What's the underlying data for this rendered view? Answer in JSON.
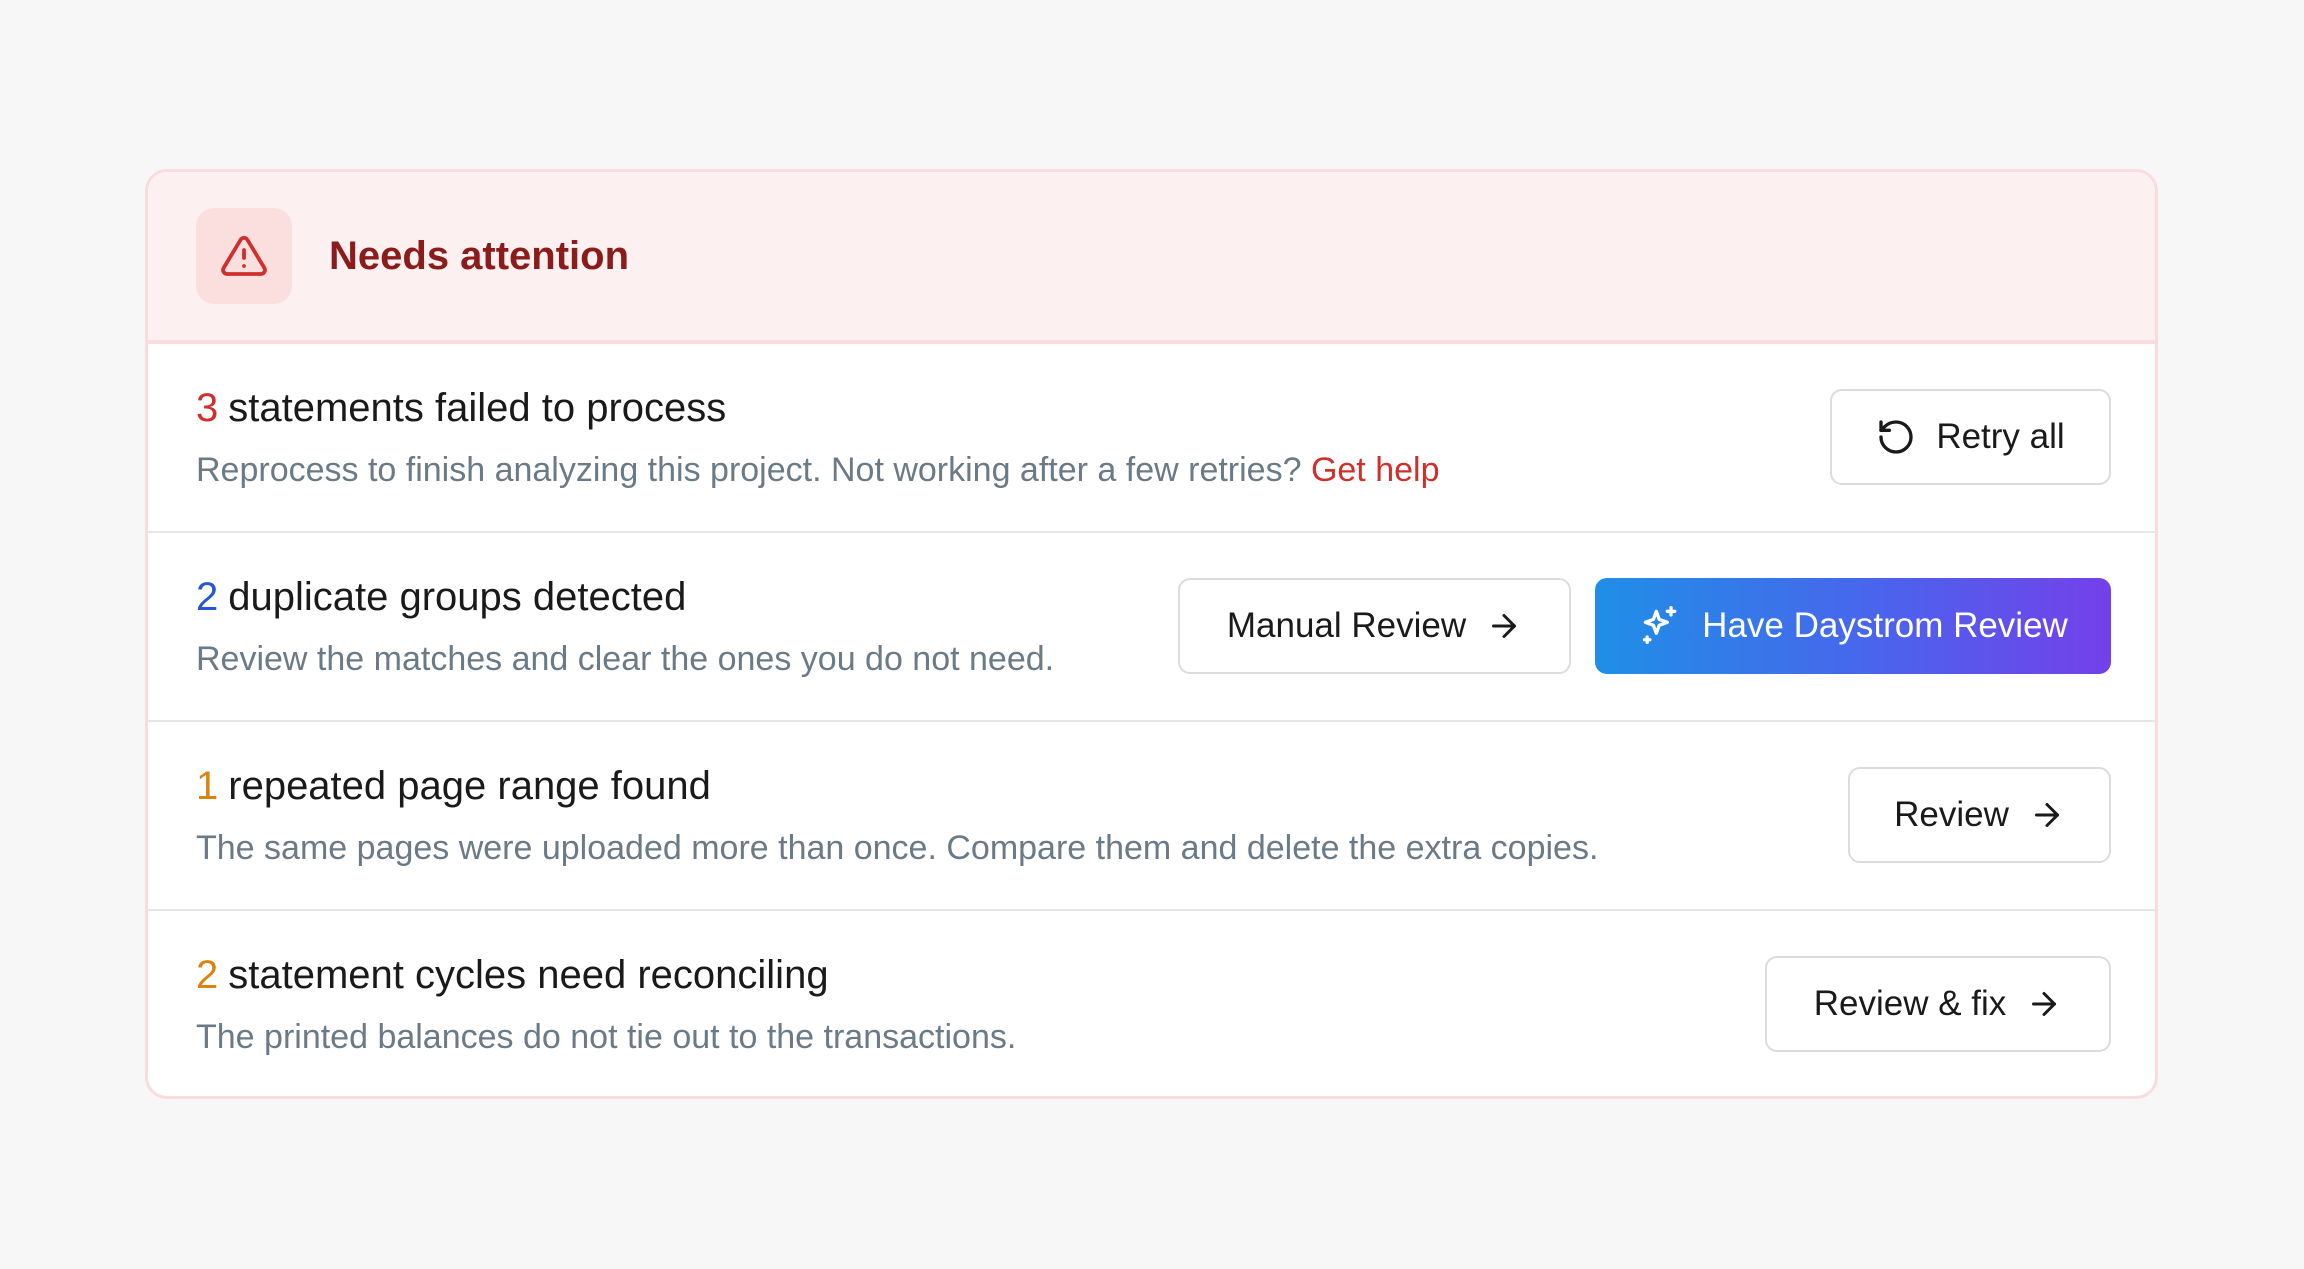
{
  "panel": {
    "title": "Needs attention",
    "header_icon": "warning-triangle-icon"
  },
  "colors": {
    "header_bg": "#fdf0f0",
    "title_color": "#8a1c1c",
    "red": "#d0302b",
    "blue": "#2456d6",
    "orange": "#d98410",
    "gradient_start": "#1f8fe6",
    "gradient_end": "#7440ea"
  },
  "issues": [
    {
      "count": "3",
      "title": "statements failed to process",
      "description": "Reprocess to finish analyzing this project.  Not working after a few retries?",
      "link": "Get help",
      "button": {
        "label": "Retry all",
        "icon": "refresh-icon"
      }
    },
    {
      "count": "2",
      "title": "duplicate groups detected",
      "description": "Review the matches and clear the ones you do not need.",
      "button_secondary": {
        "label": "Manual Review",
        "icon": "arrow-right-icon"
      },
      "button_primary": {
        "label": "Have Daystrom Review",
        "icon": "sparkles-icon"
      }
    },
    {
      "count": "1",
      "title": "repeated page range found",
      "description": "The same pages were uploaded more than once. Compare them and delete the extra copies.",
      "button": {
        "label": "Review",
        "icon": "arrow-right-icon"
      }
    },
    {
      "count": "2",
      "title": "statement cycles need reconciling",
      "description": "The printed balances do not tie out to the transactions.",
      "button": {
        "label": "Review & fix",
        "icon": "arrow-right-icon"
      }
    }
  ]
}
